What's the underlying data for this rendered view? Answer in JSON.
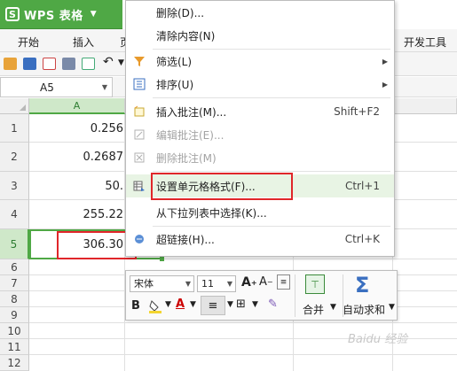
{
  "app": {
    "name": "WPS 表格",
    "logo_letter": "S"
  },
  "menu_tabs": [
    "开始",
    "插入",
    "开发工具"
  ],
  "namebox": {
    "value": "A5"
  },
  "columns": [
    "A"
  ],
  "rows": [
    "1",
    "2",
    "3",
    "4",
    "5",
    "6",
    "7",
    "8",
    "9",
    "10",
    "11",
    "12"
  ],
  "cells": [
    {
      "row": "1",
      "value": "0.256"
    },
    {
      "row": "2",
      "value": "0.2687"
    },
    {
      "row": "3",
      "value": "50."
    },
    {
      "row": "4",
      "value": "255.22"
    },
    {
      "row": "5",
      "value": "306.30"
    }
  ],
  "context_menu": {
    "items": [
      {
        "label": "删除(D)...",
        "icon": "",
        "disabled": false
      },
      {
        "label": "清除内容(N)",
        "icon": "",
        "disabled": false
      },
      {
        "label": "筛选(L)",
        "icon": "filter-icon",
        "submenu": true
      },
      {
        "label": "排序(U)",
        "icon": "sort-icon",
        "submenu": true
      },
      {
        "label": "插入批注(M)...",
        "icon": "insert-comment-icon",
        "shortcut": "Shift+F2"
      },
      {
        "label": "编辑批注(E)...",
        "icon": "edit-comment-icon",
        "disabled": true
      },
      {
        "label": "删除批注(M)",
        "icon": "delete-comment-icon",
        "disabled": true
      },
      {
        "label": "设置单元格格式(F)...",
        "icon": "format-cells-icon",
        "shortcut": "Ctrl+1",
        "highlighted": true
      },
      {
        "label": "从下拉列表中选择(K)...",
        "icon": ""
      },
      {
        "label": "超链接(H)...",
        "icon": "hyperlink-icon",
        "shortcut": "Ctrl+K"
      }
    ]
  },
  "mini_toolbar": {
    "font": "宋体",
    "size": "11",
    "merge_label": "合并",
    "autosum_label": "自动求和"
  },
  "watermark": "Baidu 经验",
  "colors": {
    "accent": "#4fa845",
    "highlight_box": "#e0262a"
  }
}
